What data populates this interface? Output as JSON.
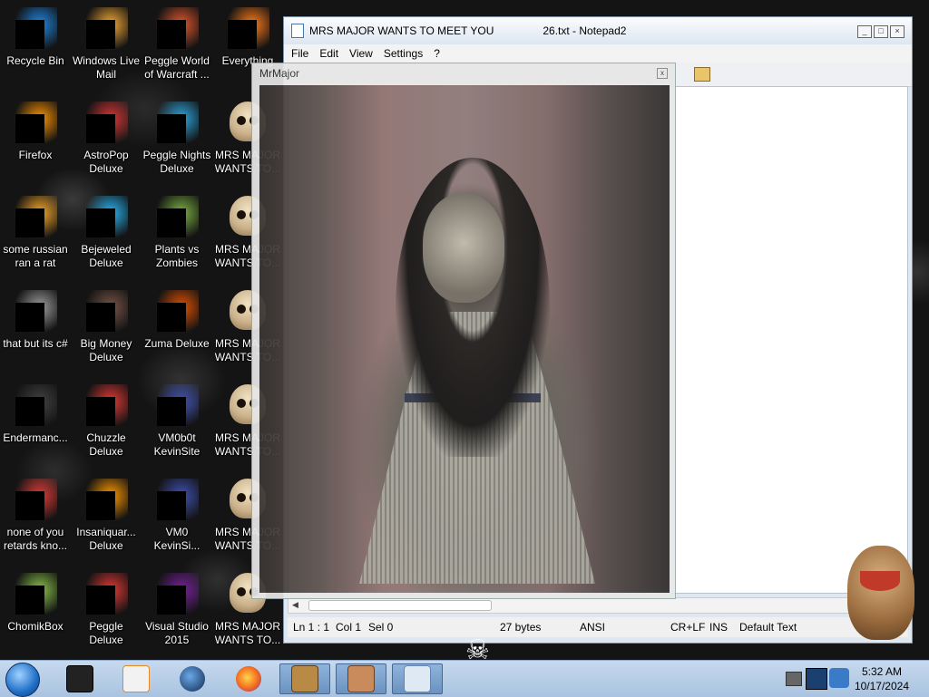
{
  "desktop": {
    "icons": [
      {
        "label": "Recycle Bin"
      },
      {
        "label": "Windows Live\nMail"
      },
      {
        "label": "Peggle World\nof Warcraft ..."
      },
      {
        "label": "Everything"
      },
      {
        "label": "Firefox"
      },
      {
        "label": "AstroPop\nDeluxe"
      },
      {
        "label": "Peggle Nights\nDeluxe"
      },
      {
        "label": "MRS MAJOR\nWANTS TO..."
      },
      {
        "label": "some russian\nran a rat"
      },
      {
        "label": "Bejeweled\nDeluxe"
      },
      {
        "label": "Plants vs\nZombies"
      },
      {
        "label": "MRS MAJOR\nWANTS TO..."
      },
      {
        "label": "that but its c#"
      },
      {
        "label": "Big Money\nDeluxe"
      },
      {
        "label": "Zuma Deluxe"
      },
      {
        "label": "MRS MAJOR\nWANTS TO..."
      },
      {
        "label": "Endermanc..."
      },
      {
        "label": "Chuzzle\nDeluxe"
      },
      {
        "label": "VM0b0t\nKevinSite"
      },
      {
        "label": "MRS MAJOR\nWANTS TO..."
      },
      {
        "label": "none of you\nretards kno..."
      },
      {
        "label": "Insaniquar...\nDeluxe"
      },
      {
        "label": "VM0\nKevinSi..."
      },
      {
        "label": "MRS MAJOR\nWANTS TO..."
      },
      {
        "label": "ChomikBox"
      },
      {
        "label": "Peggle Deluxe"
      },
      {
        "label": "Visual Studio\n2015"
      },
      {
        "label": "MRS MAJOR\nWANTS TO..."
      }
    ]
  },
  "notepad": {
    "title_left": "MRS MAJOR WANTS TO MEET YOU",
    "title_right": "26.txt - Notepad2",
    "menu": [
      "File",
      "Edit",
      "View",
      "Settings",
      "?"
    ],
    "status": {
      "position": "Ln 1 : 1",
      "col": "Col 1",
      "sel": "Sel 0",
      "size": "27 bytes",
      "encoding": "ANSI",
      "eol": "CR+LF",
      "ins": "INS",
      "scheme": "Default Text"
    }
  },
  "mrmajor": {
    "title": "MrMajor",
    "close": "x"
  },
  "taskbar": {
    "time": "5:32 AM",
    "date": "10/17/2024"
  },
  "colors": {
    "taskbar_top": "#c6d9ee",
    "taskbar_bottom": "#a9c3e0",
    "desktop_bg": "#141414"
  }
}
